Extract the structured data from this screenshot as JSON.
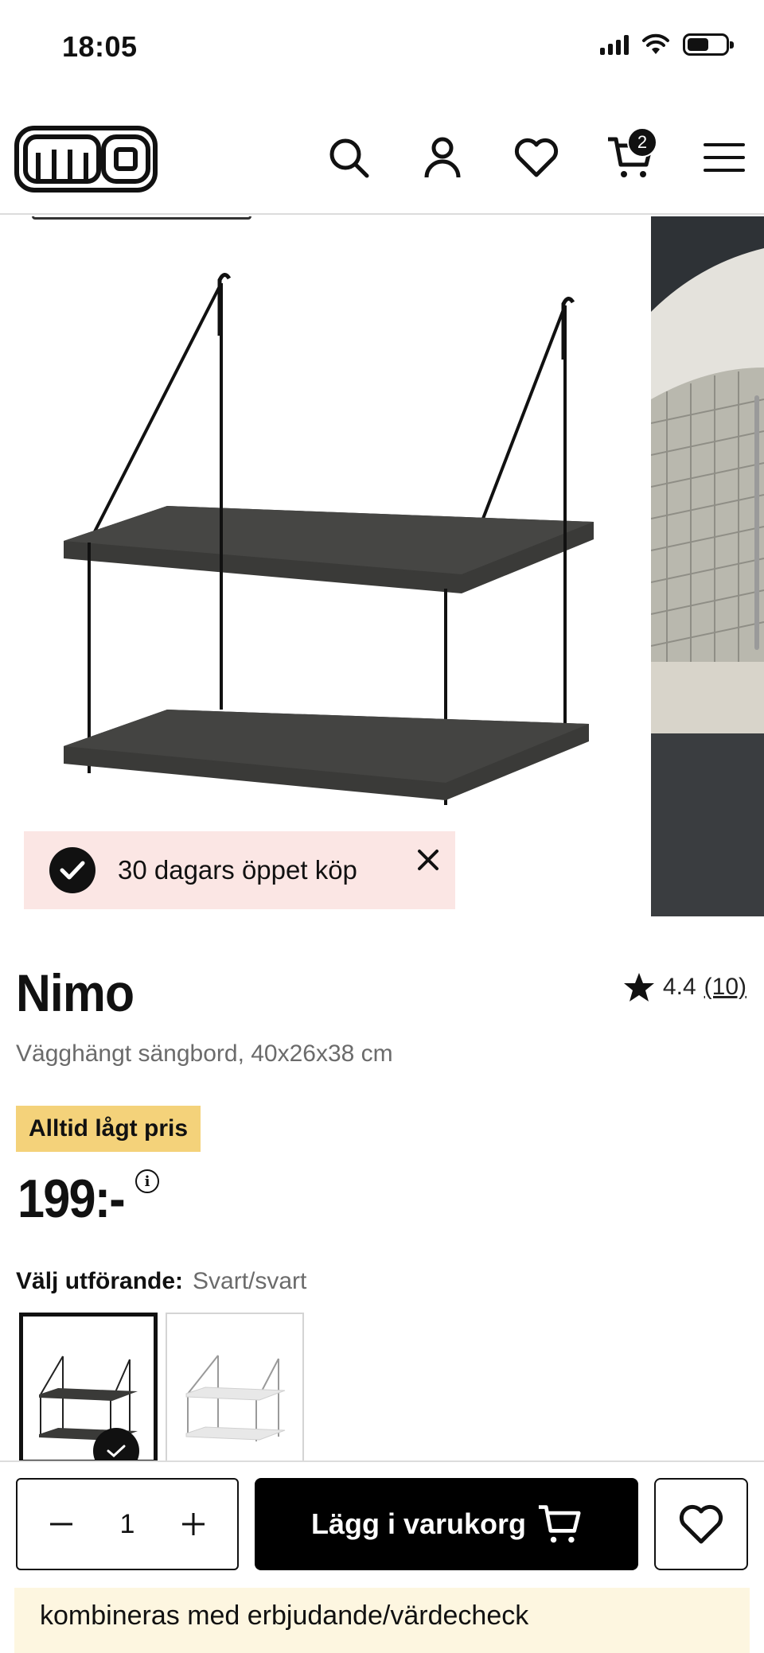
{
  "status_bar": {
    "time": "18:05"
  },
  "header": {
    "logo_text": "mio",
    "cart_count": "2",
    "icons": [
      "search-icon",
      "account-icon",
      "heart-icon",
      "cart-icon",
      "menu-icon"
    ]
  },
  "promo": {
    "text": "30 dagars öppet köp"
  },
  "product": {
    "name": "Nimo",
    "subtitle": "Vägghängt sängbord, 40x26x38 cm",
    "rating": "4.4",
    "rating_count": "(10)",
    "badge": "Alltid lågt pris",
    "price": "199:-",
    "variant_label": "Välj utförande:",
    "variant_value": "Svart/svart"
  },
  "buy_bar": {
    "quantity": "1",
    "add_to_cart": "Lägg i varukorg"
  },
  "footer_note": {
    "text": "kombineras med erbjudande/värdecheck"
  },
  "colors": {
    "accent_badge": "#f4d27a",
    "promo_bg": "#fbe6e4",
    "primary": "#000000"
  }
}
